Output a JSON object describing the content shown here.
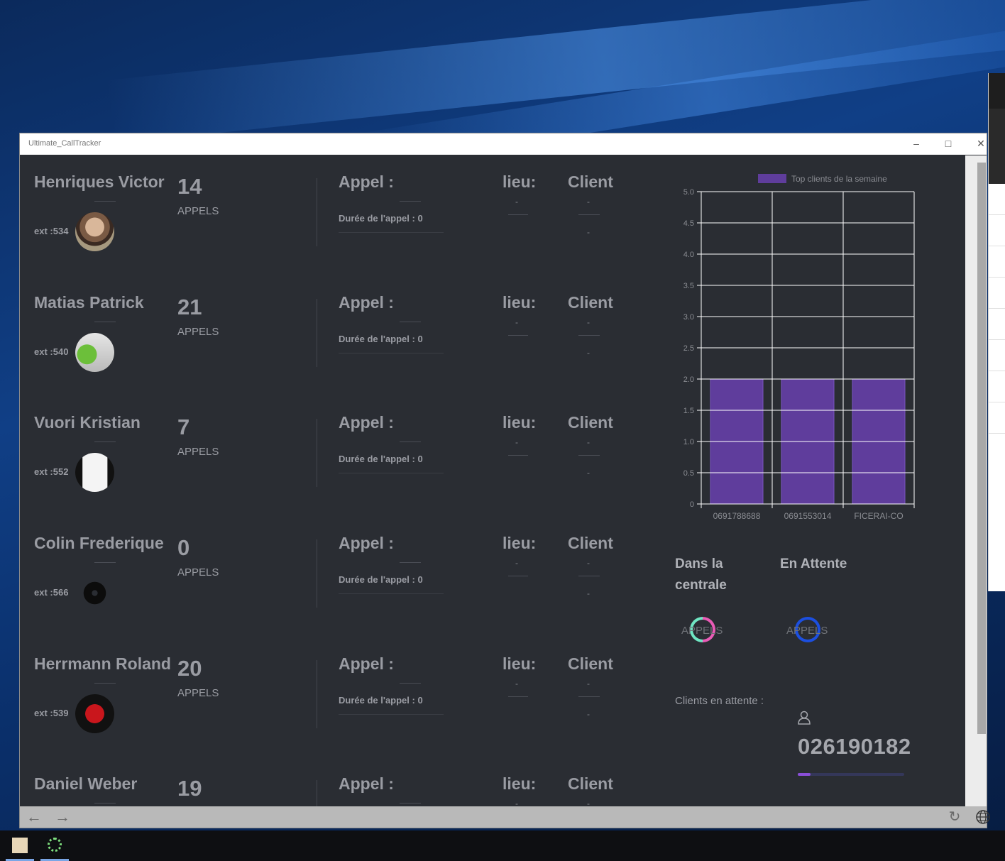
{
  "window": {
    "title": "Ultimate_CallTracker"
  },
  "labels": {
    "calls": "APPELS",
    "appel": "Appel :",
    "duree": "Durée de l'appel : 0",
    "lieu": "lieu:",
    "client": "Client",
    "dash": "-"
  },
  "agents": [
    {
      "name": "Henriques Victor",
      "ext": "ext :534",
      "calls": "14",
      "avatar": "avatar-bald-man"
    },
    {
      "name": "Matias Patrick",
      "ext": "ext :540",
      "calls": "21",
      "avatar": "avatar-android"
    },
    {
      "name": "Vuori Kristian",
      "ext": "ext :552",
      "calls": "7",
      "avatar": "avatar-card"
    },
    {
      "name": "Colin Frederique",
      "ext": "ext :566",
      "calls": "0",
      "avatar": "avatar-helmet"
    },
    {
      "name": "Herrmann Roland",
      "ext": "ext :539",
      "calls": "20",
      "avatar": "avatar-acdc"
    },
    {
      "name": "Daniel Weber",
      "ext": "",
      "calls": "19",
      "avatar": ""
    }
  ],
  "chart_data": {
    "type": "bar",
    "legend": "Top clients de la semaine",
    "categories": [
      "0691788688",
      "0691553014",
      "FICERAI-CO"
    ],
    "series": [
      {
        "name": "Top clients de la semaine",
        "values": [
          2,
          2,
          2
        ]
      }
    ],
    "ylim": [
      0,
      5
    ],
    "yticks": [
      "0",
      "0.5",
      "1.0",
      "1.5",
      "2.0",
      "2.5",
      "3.0",
      "3.5",
      "4.0",
      "4.5",
      "5.0"
    ],
    "bar_color": "#5f3d9c",
    "legend_position": "top"
  },
  "status": {
    "central_title": "Dans la centrale",
    "central_calls": "APPELS",
    "waiting_title": "En Attente",
    "waiting_calls": "APPELS"
  },
  "clients_waiting": {
    "label": "Clients en attente :",
    "number": "026190182",
    "progress": 0.12
  },
  "colors": {
    "background": "#2a2d33",
    "text": "#9a9ca3",
    "accent": "#8a4fd8",
    "ring_central_a": "#e95bb6",
    "ring_central_b": "#6fe6c3",
    "ring_waiting": "#1c4fe0"
  },
  "icons": {
    "back": "arrow-left-icon",
    "forward": "arrow-right-icon",
    "refresh": "refresh-icon",
    "globe": "globe-icon",
    "user": "user-icon"
  }
}
